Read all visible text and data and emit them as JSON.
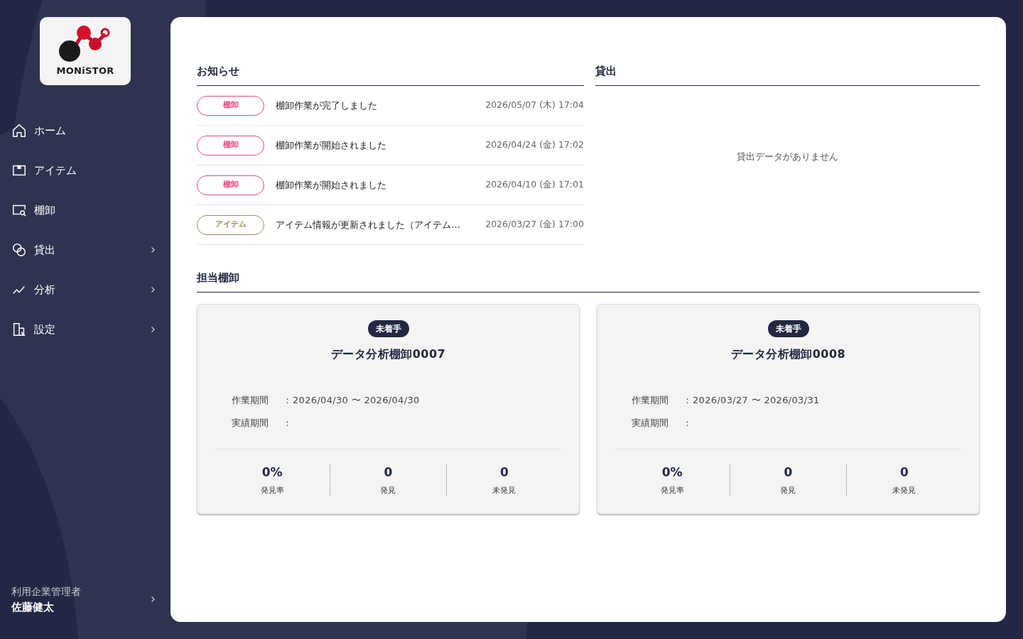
{
  "logo": {
    "text": "MONiSTOR"
  },
  "nav": [
    {
      "label": "ホーム",
      "kind": "home",
      "expandable": false
    },
    {
      "label": "アイテム",
      "kind": "item",
      "expandable": false
    },
    {
      "label": "棚卸",
      "kind": "inventory",
      "expandable": false
    },
    {
      "label": "貸出",
      "kind": "loan",
      "expandable": true
    },
    {
      "label": "分析",
      "kind": "chart",
      "expandable": true
    },
    {
      "label": "設定",
      "kind": "settings",
      "expandable": true
    }
  ],
  "user": {
    "role": "利用企業管理者",
    "name": "佐藤健太"
  },
  "notices": {
    "title": "お知らせ",
    "items": [
      {
        "tag": "棚卸",
        "color": "#e8457f",
        "text": "棚卸作業が完了しました",
        "date": "2026/05/07 (木) 17:04"
      },
      {
        "tag": "棚卸",
        "color": "#e8457f",
        "text": "棚卸作業が開始されました",
        "date": "2026/04/24 (金) 17:02"
      },
      {
        "tag": "棚卸",
        "color": "#e8457f",
        "text": "棚卸作業が開始されました",
        "date": "2026/04/10 (金) 17:01"
      },
      {
        "tag": "アイテム",
        "color": "#a08a5c",
        "text": "アイテム情報が更新されました（アイテム…",
        "date": "2026/03/27 (金) 17:00"
      }
    ]
  },
  "loans": {
    "title": "貸出",
    "empty": "貸出データがありません"
  },
  "assigned": {
    "title": "担当棚卸",
    "cards": [
      {
        "status": "未着手",
        "name": "データ分析棚卸0007",
        "fields": [
          {
            "label": "作業期間",
            "sep": "：",
            "value": "2026/04/30 〜 2026/04/30"
          },
          {
            "label": "実績期間",
            "sep": "："
          }
        ],
        "stats": [
          {
            "value": "0%",
            "label": "発見率"
          },
          {
            "value": "0",
            "label": "発見"
          },
          {
            "value": "0",
            "label": "未発見"
          }
        ]
      },
      {
        "status": "未着手",
        "name": "データ分析棚卸0008",
        "fields": [
          {
            "label": "作業期間",
            "sep": "：",
            "value": "2026/03/27 〜 2026/03/31"
          },
          {
            "label": "実績期間",
            "sep": "："
          }
        ],
        "stats": [
          {
            "value": "0%",
            "label": "発見率"
          },
          {
            "value": "0",
            "label": "発見"
          },
          {
            "value": "0",
            "label": "未発見"
          }
        ]
      }
    ]
  }
}
